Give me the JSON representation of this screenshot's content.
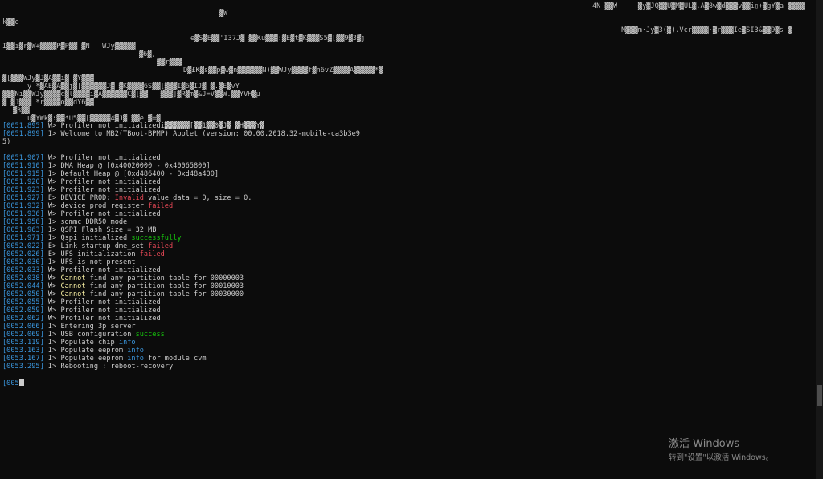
{
  "garbage": [
    "▓W",
    "4N ▓▓W     ▓y▓JQ▓▓U▓M▓UL▓.A▓8w▓d▓▓▓v▓▓i▯+▓gY▓a ▓▓▓▓",
    "k▓▓e",
    "N▓▓▓m·Jy▓3(▓(.Vcr▓▓▓▓·▓r▓▓▓Ie▓SI3&▓▓9▓s ▓",
    "e▓S▓E▓▓'I37J▓ ▓▓Ku▓▓▓:▓E▓t▓K▓▓▓S5▓[▓▓9▓3▓j",
    "I▓▓i▓r▓W+▓▓▓▓P▓P▓▓ ▓N  'WJy▓▓▓▓▓",
    "▓6▓,",
    "▓▓r▓▓▓",
    "D▓£K▓s▓▓p▓w▓n▓▓▓▓▓▓N)▓▓WJy▓▓▓▓f▓n6vZ▓▓▓▓A▓▓▓▓▓*▓",
    "▓[▓▓▓WJy▓J▓A▓▓i▓ ▓Y▓▓▓",
    "y *▓AE▓A▓▓j▓[▓▓▓▓▓▓J▓ ▓K▓▓▓▓6S▓▓[▓▓▓I▓6▓IJ▓ ▓.▓E▓vY",
    "▓▓▓Ni▓▓WJy▓▓▓▓c▓l▓▓▓▓i▓A▓▓▓▓▓▓C▓[▓▓   ▓▓▓]▓R▓m▓&J=V▓▓W.▓▓YVH▓µ",
    "▓ ▓J▓▓▓ *r▓▓▓▓o▓▓dY6▓▓",
    "▓3▓▓",
    "u▓YWk▓:▓▓*U5▓▓[▓▓▓▓▓4▓J▓ ▓▓e ▓=▓"
  ],
  "log_lines": [
    [
      {
        "t": "[0051.895]",
        "c": "ts"
      },
      {
        "t": " W> Profiler not initializedi▓▓▓▓▓▓[▓▓1▓▓0▓J▓ ▓H▓▓▓Y▓"
      }
    ],
    [
      {
        "t": "[0051.899]",
        "c": "ts"
      },
      {
        "t": " I> Welcome to MB2(TBoot-BPMP) Applet (version: 00.00.2018.32-mobile-ca3b3e9"
      }
    ],
    [
      {
        "t": "5)"
      }
    ],
    [],
    [
      {
        "t": "[0051.907]",
        "c": "ts"
      },
      {
        "t": " W> Profiler not initialized"
      }
    ],
    [
      {
        "t": "[0051.910]",
        "c": "ts"
      },
      {
        "t": " I> DMA Heap @ [0x40020000 - 0x40065800]"
      }
    ],
    [
      {
        "t": "[0051.915]",
        "c": "ts"
      },
      {
        "t": " I> Default Heap @ [0xd486400 - 0xd48a400]"
      }
    ],
    [
      {
        "t": "[0051.920]",
        "c": "ts"
      },
      {
        "t": " W> Profiler not initialized"
      }
    ],
    [
      {
        "t": "[0051.923]",
        "c": "ts"
      },
      {
        "t": " W> Profiler not initialized"
      }
    ],
    [
      {
        "t": "[0051.927]",
        "c": "ts"
      },
      {
        "t": " E> DEVICE_PROD: "
      },
      {
        "t": "Invalid",
        "c": "w-red"
      },
      {
        "t": " value data = 0, size = 0."
      }
    ],
    [
      {
        "t": "[0051.932]",
        "c": "ts"
      },
      {
        "t": " W> device_prod register "
      },
      {
        "t": "failed",
        "c": "w-red"
      }
    ],
    [
      {
        "t": "[0051.936]",
        "c": "ts"
      },
      {
        "t": " W> Profiler not initialized"
      }
    ],
    [
      {
        "t": "[0051.958]",
        "c": "ts"
      },
      {
        "t": " I> sdmmc DDR50 mode"
      }
    ],
    [
      {
        "t": "[0051.963]",
        "c": "ts"
      },
      {
        "t": " I> QSPI Flash Size = 32 MB"
      }
    ],
    [
      {
        "t": "[0051.971]",
        "c": "ts"
      },
      {
        "t": " I> Qspi initialized "
      },
      {
        "t": "successfully",
        "c": "w-green"
      }
    ],
    [
      {
        "t": "[0052.022]",
        "c": "ts"
      },
      {
        "t": " E> Link startup dme_set "
      },
      {
        "t": "failed",
        "c": "w-red"
      }
    ],
    [
      {
        "t": "[0052.026]",
        "c": "ts"
      },
      {
        "t": " E> UFS initialization "
      },
      {
        "t": "failed",
        "c": "w-red"
      }
    ],
    [
      {
        "t": "[0052.030]",
        "c": "ts"
      },
      {
        "t": " I> UFS is not present"
      }
    ],
    [
      {
        "t": "[0052.033]",
        "c": "ts"
      },
      {
        "t": " W> Profiler not initialized"
      }
    ],
    [
      {
        "t": "[0052.038]",
        "c": "ts"
      },
      {
        "t": " W> "
      },
      {
        "t": "Cannot",
        "c": "w-yellow"
      },
      {
        "t": " find any partition table for 00000003"
      }
    ],
    [
      {
        "t": "[0052.044]",
        "c": "ts"
      },
      {
        "t": " W> "
      },
      {
        "t": "Cannot",
        "c": "w-yellow"
      },
      {
        "t": " find any partition table for 00010003"
      }
    ],
    [
      {
        "t": "[0052.050]",
        "c": "ts"
      },
      {
        "t": " W> "
      },
      {
        "t": "Cannot",
        "c": "w-yellow"
      },
      {
        "t": " find any partition table for 00030000"
      }
    ],
    [
      {
        "t": "[0052.055]",
        "c": "ts"
      },
      {
        "t": " W> Profiler not initialized"
      }
    ],
    [
      {
        "t": "[0052.059]",
        "c": "ts"
      },
      {
        "t": " W> Profiler not initialized"
      }
    ],
    [
      {
        "t": "[0052.062]",
        "c": "ts"
      },
      {
        "t": " W> Profiler not initialized"
      }
    ],
    [
      {
        "t": "[0052.066]",
        "c": "ts"
      },
      {
        "t": " I> Entering 3p server"
      }
    ],
    [
      {
        "t": "[0052.069]",
        "c": "ts"
      },
      {
        "t": " I> USB configuration "
      },
      {
        "t": "success",
        "c": "w-green"
      }
    ],
    [
      {
        "t": "[0053.119]",
        "c": "ts"
      },
      {
        "t": " I> Populate chip "
      },
      {
        "t": "info",
        "c": "w-blue"
      }
    ],
    [
      {
        "t": "[0053.163]",
        "c": "ts"
      },
      {
        "t": " I> Populate eeprom "
      },
      {
        "t": "info",
        "c": "w-blue"
      }
    ],
    [
      {
        "t": "[0053.167]",
        "c": "ts"
      },
      {
        "t": " I> Populate eeprom "
      },
      {
        "t": "info",
        "c": "w-blue"
      },
      {
        "t": " for module cvm"
      }
    ],
    [
      {
        "t": "[0053.295]",
        "c": "ts"
      },
      {
        "t": " I> Rebooting : reboot-recovery"
      }
    ]
  ],
  "prompt": {
    "text": "[005"
  },
  "watermark": {
    "title": "激活 Windows",
    "subtitle": "转到\"设置\"以激活 Windows。"
  },
  "colors": {
    "background": "#0c0c0c",
    "text": "#cccccc",
    "timestamp": "#3a96dd",
    "error": "#e74856",
    "success": "#16c60c",
    "warning": "#f9f1a5",
    "info": "#3a96dd"
  }
}
